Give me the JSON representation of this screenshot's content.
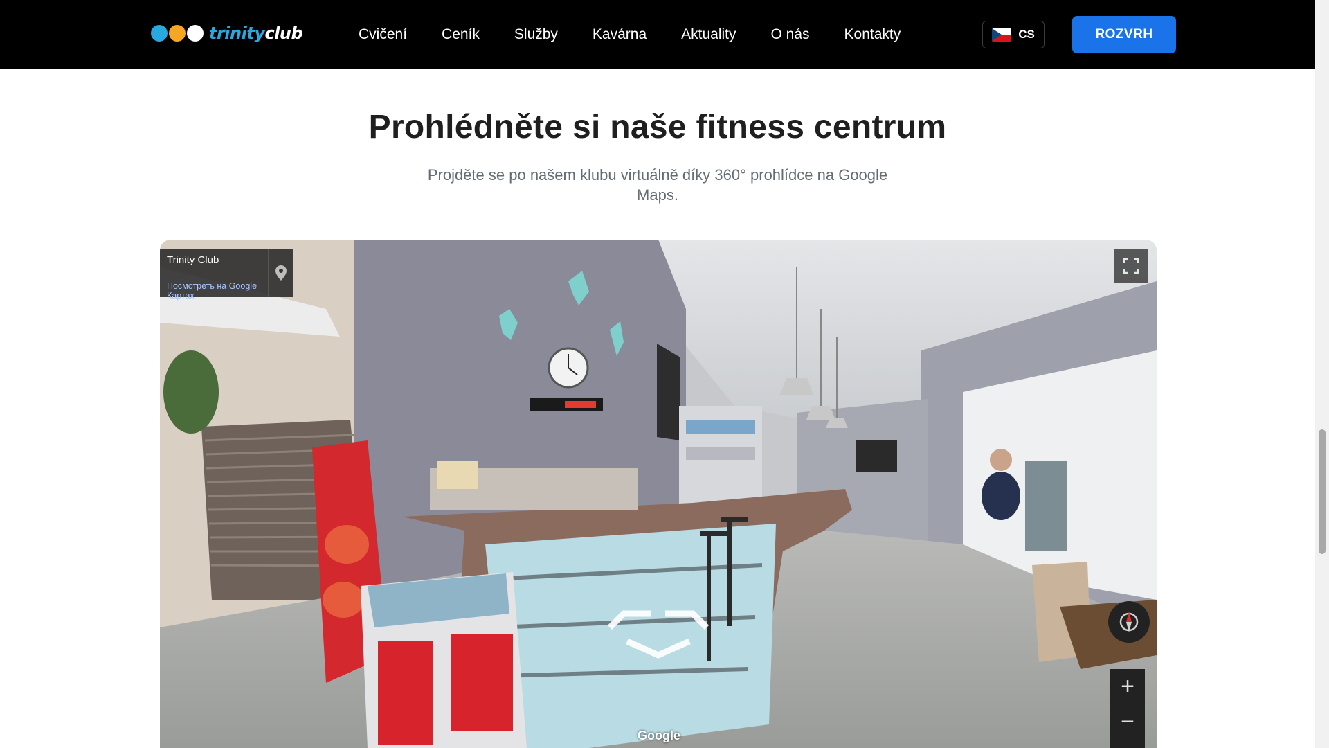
{
  "header": {
    "logo_text_part1": "trinity",
    "logo_text_part2": "club",
    "logo_dot_colors": [
      "#29a8e0",
      "#f5a623",
      "#ffffff"
    ],
    "nav_items": [
      {
        "label": "Cvičení"
      },
      {
        "label": "Ceník"
      },
      {
        "label": "Služby"
      },
      {
        "label": "Kavárna"
      },
      {
        "label": "Aktuality"
      },
      {
        "label": "O nás"
      },
      {
        "label": "Kontakty"
      }
    ],
    "language": {
      "code": "CS",
      "icon": "czech-flag-icon"
    },
    "cta_label": "ROZVRH",
    "accent_color": "#1a73e8"
  },
  "section": {
    "title": "Prohlédněte si naše fitness centrum",
    "subtitle": "Projděte se po našem klubu virtuálně díky 360° prohlídce na Google Maps."
  },
  "streetview": {
    "place_name": "Trinity Club",
    "view_link": "Посмотреть на Google Картах",
    "brand": "Google",
    "zoom_in": "+",
    "zoom_out": "−",
    "icons": [
      "map-pin-icon",
      "fullscreen-icon",
      "compass-icon",
      "navigation-arrow-icon"
    ]
  }
}
